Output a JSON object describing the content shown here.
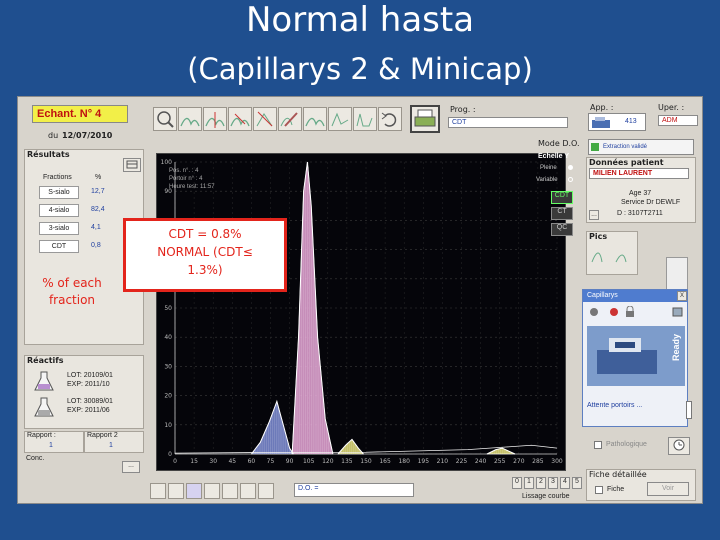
{
  "slide": {
    "title": "Normal hasta",
    "subtitle": "(Capillarys 2 & Minicap)"
  },
  "sample": {
    "label": "Echant. N° 4",
    "date_prefix": "du",
    "date": "12/07/2010"
  },
  "prog": {
    "label": "Prog. :",
    "value": "CDT"
  },
  "app": {
    "label": "App. :",
    "value": "413"
  },
  "uper": {
    "label": "Uper. :",
    "value": "ADM"
  },
  "mode": {
    "label": "Mode D.O."
  },
  "scale": {
    "title": "Echelle Y",
    "options": [
      "Pleine",
      "Variable"
    ]
  },
  "panel_tabs": [
    "CDT",
    "CT",
    "QC"
  ],
  "results": {
    "title": "Résultats",
    "col_fraction": "Fractions",
    "col_pct": "%",
    "rows": [
      {
        "name": "S-sialo",
        "value": "12,7"
      },
      {
        "name": "4-sialo",
        "value": "82,4"
      },
      {
        "name": "3-sialo",
        "value": "4,1"
      },
      {
        "name": "CDT",
        "value": "0,8"
      }
    ]
  },
  "reagents": {
    "title": "Réactifs",
    "items": [
      {
        "lot": "LOT: 20109/01",
        "exp": "EXP: 2011/10"
      },
      {
        "lot": "LOT: 30089/01",
        "exp": "EXP: 2011/06"
      }
    ]
  },
  "reports": {
    "rapport1_label": "Rapport :",
    "rapport1_value": "1",
    "rapport2_label": "Rapport 2",
    "rapport2_value": "1",
    "conc_label": "Conc.",
    "more": "..."
  },
  "patient": {
    "title": "Données patient",
    "name": "MILIEN LAURENT",
    "age": "Age 37",
    "service": "Service Dr DEWLF",
    "id": "D : 3107T2711",
    "more": "..."
  },
  "extraction": "Extraction validé",
  "pics": {
    "title": "Pics"
  },
  "capillarys_dialog": {
    "title": "Capillarys",
    "close": "X",
    "ready": "Ready",
    "status": "Attente portoirs ..."
  },
  "pathologique": "Pathologique",
  "fiche": {
    "title": "Fiche détaillée",
    "label": "Fiche",
    "button": "Voir"
  },
  "do_field": {
    "label": "D.O. ="
  },
  "smoothing": {
    "label": "Lissage courbe",
    "options": [
      "0",
      "1",
      "2",
      "3",
      "4",
      "5"
    ]
  },
  "plot_info": {
    "pos": "Pos. n°.   : 4",
    "portoir": "Portoir n°  : 4",
    "heure": "Heure test: 11:57"
  },
  "annotation": {
    "line1": "CDT = 0.8%",
    "line2": "NORMAL (CDT≤",
    "line3": "1.3%)"
  },
  "side_note": {
    "line1": "% of each",
    "line2": "fraction"
  },
  "icons": [
    "zoom-icon",
    "peak-add-icon",
    "peak-delete-icon",
    "rescale-icon",
    "edit-icon",
    "print-icon",
    "undo-icon",
    "settings-icon"
  ],
  "chart_data": {
    "type": "area",
    "title": "",
    "xlabel": "",
    "ylabel": "",
    "x_ticks": [
      0,
      15,
      30,
      45,
      60,
      75,
      90,
      105,
      120,
      135,
      150,
      165,
      180,
      195,
      210,
      225,
      240,
      255,
      270,
      285,
      300
    ],
    "y_ticks": [
      0,
      10,
      20,
      30,
      40,
      50,
      60,
      70,
      80,
      90,
      100
    ],
    "xlim": [
      0,
      300
    ],
    "ylim": [
      0,
      100
    ],
    "grid": true,
    "series": [
      {
        "name": "S-sialo",
        "color": "#7f8ed8",
        "points": [
          [
            60,
            0
          ],
          [
            67,
            4
          ],
          [
            74,
            11
          ],
          [
            80,
            18
          ],
          [
            85,
            10
          ],
          [
            90,
            2
          ],
          [
            93,
            0
          ]
        ]
      },
      {
        "name": "4-sialo",
        "color": "#e9a6d8",
        "points": [
          [
            92,
            0
          ],
          [
            97,
            40
          ],
          [
            101,
            90
          ],
          [
            104,
            100
          ],
          [
            107,
            85
          ],
          [
            112,
            40
          ],
          [
            118,
            12
          ],
          [
            124,
            0
          ]
        ]
      },
      {
        "name": "3-sialo",
        "color": "#e6e27a",
        "points": [
          [
            128,
            0
          ],
          [
            134,
            3
          ],
          [
            139,
            5
          ],
          [
            144,
            2
          ],
          [
            148,
            0
          ]
        ]
      },
      {
        "name": "CDT",
        "color": "#e6e27a",
        "points": [
          [
            245,
            0
          ],
          [
            252,
            1.5
          ],
          [
            257,
            2
          ],
          [
            262,
            1
          ],
          [
            267,
            0
          ]
        ]
      }
    ],
    "baseline": [
      [
        0,
        0.3
      ],
      [
        60,
        0.5
      ],
      [
        150,
        0.6
      ],
      [
        230,
        1.5
      ],
      [
        260,
        2.4
      ],
      [
        280,
        3
      ],
      [
        300,
        2
      ]
    ]
  }
}
